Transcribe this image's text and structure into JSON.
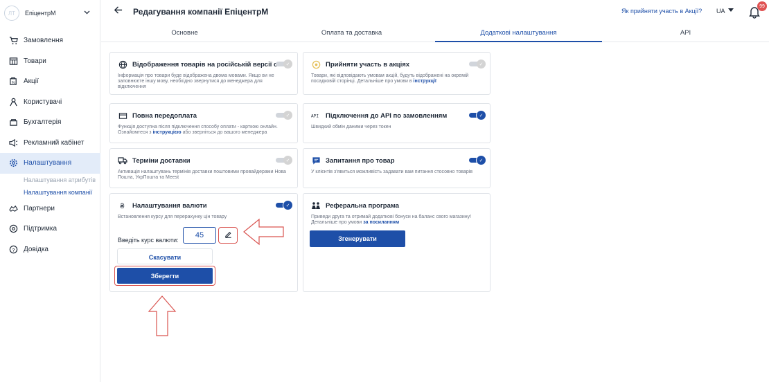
{
  "sidebar": {
    "avatar": "ЛТ",
    "brand": "ЕпіцентрМ",
    "items": [
      {
        "label": "Замовлення",
        "icon": "cart-icon"
      },
      {
        "label": "Товари",
        "icon": "products-icon"
      },
      {
        "label": "Акції",
        "icon": "promo-icon"
      },
      {
        "label": "Користувачі",
        "icon": "users-icon"
      },
      {
        "label": "Бухгалтерія",
        "icon": "accounting-icon"
      },
      {
        "label": "Рекламний кабінет",
        "icon": "megaphone-icon"
      },
      {
        "label": "Налаштування",
        "icon": "gear-icon"
      },
      {
        "label": "Партнери",
        "icon": "handshake-icon"
      },
      {
        "label": "Підтримка",
        "icon": "support-icon"
      },
      {
        "label": "Довідка",
        "icon": "help-icon"
      }
    ],
    "sub_items": [
      "Налаштування атрибутів",
      "Налаштування компанії"
    ]
  },
  "header": {
    "title": "Редагування компанії ЕпіцентрМ",
    "join_link": "Як прийняти участь в Акції?",
    "language": "UA",
    "notification_count": "99"
  },
  "tabs": [
    "Основне",
    "Оплата та доставка",
    "Додаткові налаштування",
    "API"
  ],
  "active_tab": "Додаткові налаштування",
  "cards": {
    "russian": {
      "title": "Відображення товарів на російській версії сайту",
      "desc": "Інформація про товари буде відображена двома мовами. Якщо ви не заповнюєте іншу мову, необхідно звернутися до менеджера для відключення",
      "enabled": false
    },
    "promo": {
      "title": "Прийняти участь в акціях",
      "desc": "Товари, які відповідають умовам акцій, будуть відображені на окремій посадковій сторінці. Детальніше про умови в",
      "link": "інструкції",
      "enabled": false
    },
    "prepay": {
      "title": "Повна передоплата",
      "desc1": "Функція доступна після підключення способу оплати - карткою онлайн.",
      "desc2a": "Ознайомтеся з",
      "link": "інструкцією",
      "desc2b": "або зверніться до вашого менеджера",
      "enabled": false
    },
    "api_orders": {
      "title": "Підключення до API по замовленням",
      "desc": "Швидкий обмін даними через токен",
      "enabled": true
    },
    "delivery": {
      "title": "Терміни доставки",
      "desc": "Активація налаштувань термінів доставки поштовими провайдерами Нова Пошта, УкрПошта та Meest",
      "enabled": false
    },
    "questions": {
      "title": "Запитання про товар",
      "desc": "У клієнтів з'явиться можливість задавати вам питання стосовно товарів",
      "enabled": true
    },
    "currency": {
      "title": "Налаштування валюти",
      "desc": "Встановлення курсу для перерахунку цін товару",
      "rate_label": "Введіть курс валюти:",
      "rate_value": "45",
      "cancel": "Скасувати",
      "save": "Зберегти",
      "enabled": true
    },
    "referral": {
      "title": "Реферальна програма",
      "desc1": "Приведи друга та отримай додаткові бонуси на баланс свого магазину!",
      "desc2": "Детальніше про умови",
      "link": "за посиланням",
      "button": "Згенерувати"
    }
  },
  "colors": {
    "accent": "#1e4fa8",
    "annotation": "#d9534f",
    "toggle_off": "#d1d5db"
  }
}
